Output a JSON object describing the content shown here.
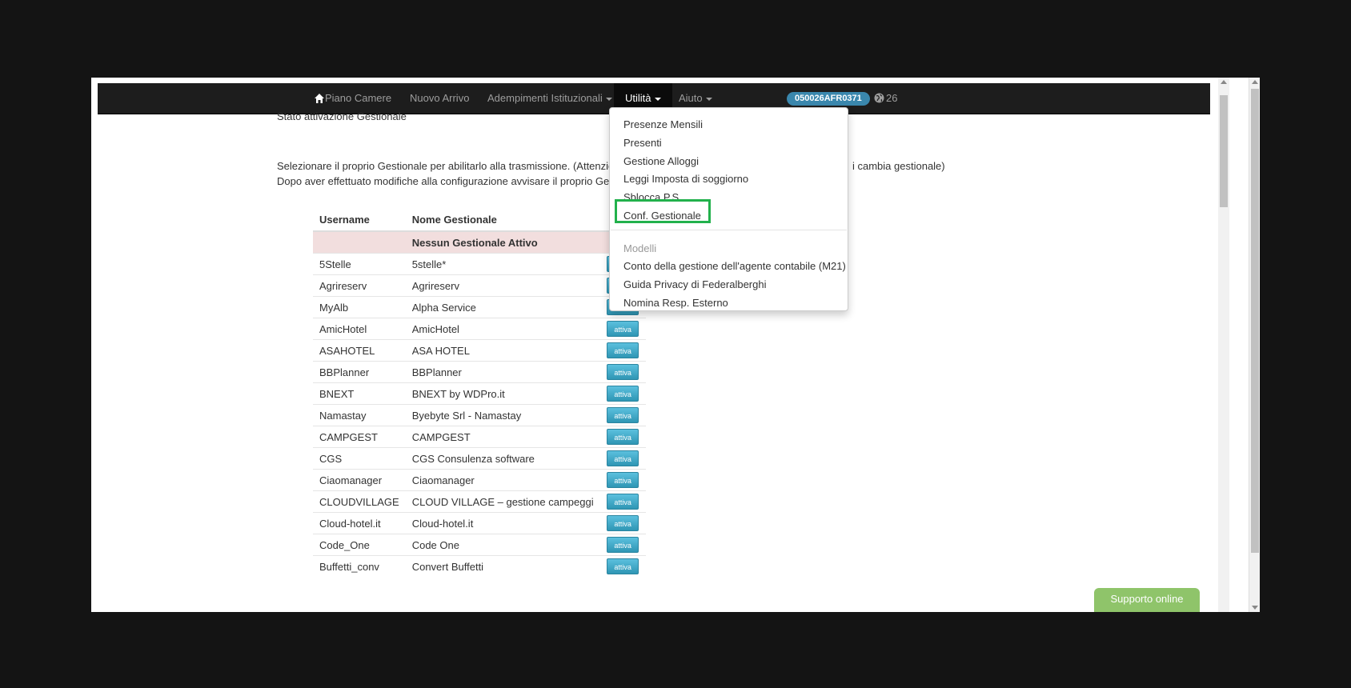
{
  "navbar": {
    "piano_camere": "Piano Camere",
    "nuovo_arrivo": "Nuovo Arrivo",
    "adempimenti": "Adempimenti Istituzionali",
    "utilita": "Utilità",
    "aiuto": "Aiuto",
    "badge": "050026AFR0371",
    "globe_count": "26"
  },
  "page": {
    "title": "Stato attivazione Gestionale",
    "instruction_1_a": "Selezionare il proprio Gestionale per abilitarlo alla trasmissione. (Attenzione",
    "instruction_1_b": "i cambia gestionale)",
    "instruction_2": "Dopo aver effettuato modifiche alla configurazione avvisare il proprio Gestio"
  },
  "table": {
    "col_username": "Username",
    "col_nome": "Nome Gestionale",
    "none_label": "Nessun Gestionale Attivo",
    "button_label": "attiva",
    "rows": [
      {
        "username": "5Stelle",
        "name": "5stelle*"
      },
      {
        "username": "Agrireserv",
        "name": "Agrireserv"
      },
      {
        "username": "MyAlb",
        "name": "Alpha Service"
      },
      {
        "username": "AmicHotel",
        "name": "AmicHotel"
      },
      {
        "username": "ASAHOTEL",
        "name": "ASA HOTEL"
      },
      {
        "username": "BBPlanner",
        "name": "BBPlanner"
      },
      {
        "username": "BNEXT",
        "name": "BNEXT by WDPro.it"
      },
      {
        "username": "Namastay",
        "name": "Byebyte Srl - Namastay"
      },
      {
        "username": "CAMPGEST",
        "name": "CAMPGEST"
      },
      {
        "username": "CGS",
        "name": "CGS Consulenza software"
      },
      {
        "username": "Ciaomanager",
        "name": "Ciaomanager"
      },
      {
        "username": "CLOUDVILLAGE",
        "name": "CLOUD VILLAGE – gestione campeggi"
      },
      {
        "username": "Cloud-hotel.it",
        "name": "Cloud-hotel.it"
      },
      {
        "username": "Code_One",
        "name": "Code One"
      },
      {
        "username": "Buffetti_conv",
        "name": "Convert Buffetti"
      }
    ]
  },
  "dropdown": {
    "items": [
      "Presenze Mensili",
      "Presenti",
      "Gestione Alloggi",
      "Leggi Imposta di soggiorno",
      "Sblocca P.S.",
      "Conf. Gestionale"
    ],
    "header": "Modelli",
    "items2": [
      "Conto della gestione dell'agente contabile (M21)",
      "Guida Privacy di Federalberghi",
      "Nomina Resp. Esterno"
    ]
  },
  "support": "Supporto online",
  "colors": {
    "navbar": "#1d1d1d",
    "badge": "#3a87ad",
    "attiva_button": "#5bc0de",
    "highlight": "#22b14c",
    "support": "#8fc46a",
    "none_row": "#f2dede"
  }
}
